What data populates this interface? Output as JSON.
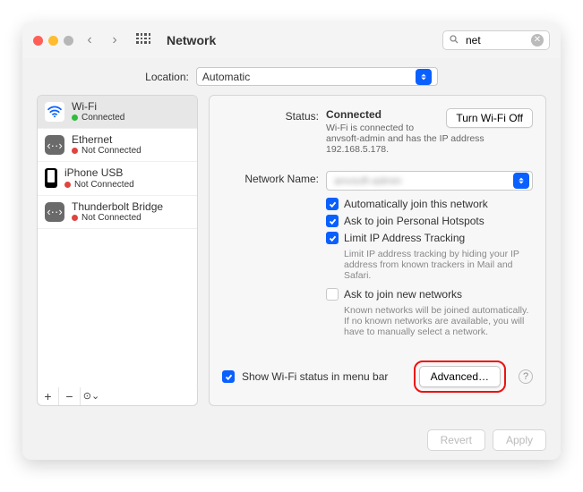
{
  "window": {
    "title": "Network"
  },
  "search": {
    "value": "net"
  },
  "location": {
    "label": "Location:",
    "value": "Automatic"
  },
  "services": [
    {
      "name": "Wi-Fi",
      "status": "Connected",
      "dot": "green",
      "icon": "wifi"
    },
    {
      "name": "Ethernet",
      "status": "Not Connected",
      "dot": "red",
      "icon": "eth"
    },
    {
      "name": "iPhone USB",
      "status": "Not Connected",
      "dot": "red",
      "icon": "iphone"
    },
    {
      "name": "Thunderbolt Bridge",
      "status": "Not Connected",
      "dot": "red",
      "icon": "tb"
    }
  ],
  "main": {
    "status_label": "Status:",
    "status_value": "Connected",
    "wifi_off_btn": "Turn Wi-Fi Off",
    "status_desc": "Wi-Fi is connected to anvsoft-admin and has the IP address 192.168.5.178.",
    "netname_label": "Network Name:",
    "netname_value": "anvsoft-admin",
    "ck_auto_join": "Automatically join this network",
    "ck_personal_hotspot": "Ask to join Personal Hotspots",
    "ck_limit_ip": "Limit IP Address Tracking",
    "limit_ip_hint": "Limit IP address tracking by hiding your IP address from known trackers in Mail and Safari.",
    "ck_ask_new": "Ask to join new networks",
    "ask_new_hint": "Known networks will be joined automatically. If no known networks are available, you will have to manually select a network.",
    "show_menubar": "Show Wi-Fi status in menu bar",
    "advanced_btn": "Advanced…"
  },
  "footer": {
    "revert": "Revert",
    "apply": "Apply"
  }
}
